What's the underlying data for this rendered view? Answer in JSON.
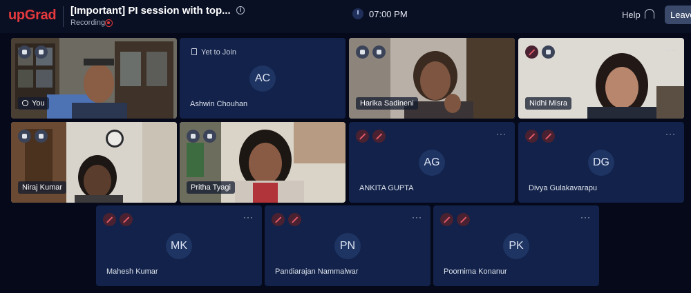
{
  "header": {
    "logo": "upGrad",
    "title": "[Important] PI session with top...",
    "recording_label": "Recording",
    "time": "07:00 PM",
    "help_label": "Help",
    "leave_label": "Leave"
  },
  "tiles": {
    "you": {
      "name": "You"
    },
    "ashwin": {
      "status": "Yet to Join",
      "initials": "AC",
      "name": "Ashwin Chouhan"
    },
    "harika": {
      "name": "Harika Sadineni"
    },
    "nidhi": {
      "name": "Nidhi Misra"
    },
    "niraj": {
      "name": "Niraj Kumar"
    },
    "pritha": {
      "name": "Pritha Tyagi"
    },
    "ankita": {
      "initials": "AG",
      "name": "ANKITA GUPTA"
    },
    "divya": {
      "initials": "DG",
      "name": "Divya Gulakavarapu"
    },
    "mahesh": {
      "initials": "MK",
      "name": "Mahesh Kumar"
    },
    "pandiarajan": {
      "initials": "PN",
      "name": "Pandiarajan Nammalwar"
    },
    "poornima": {
      "initials": "PK",
      "name": "Poornima Konanur"
    }
  },
  "more_glyph": "···",
  "colors": {
    "brand": "#e4393c",
    "background": "#05091a",
    "tile": "#12224a",
    "avatar": "#1e3463"
  }
}
